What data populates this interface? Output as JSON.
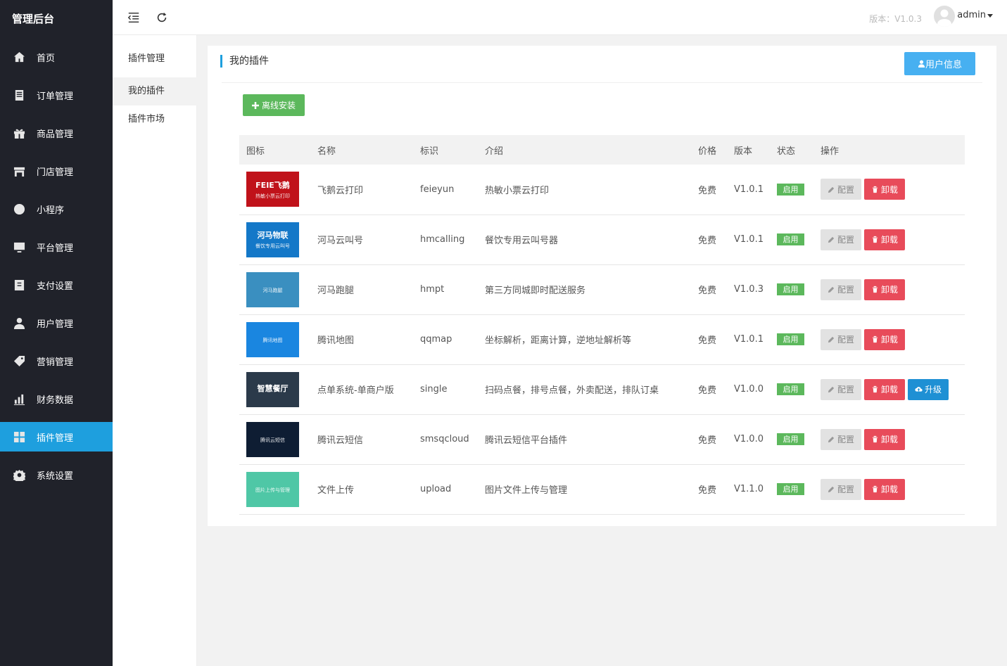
{
  "sidebar": {
    "brand": "管理后台",
    "items": [
      {
        "label": "首页",
        "icon": "home-icon"
      },
      {
        "label": "订单管理",
        "icon": "order-icon"
      },
      {
        "label": "商品管理",
        "icon": "gift-icon"
      },
      {
        "label": "门店管理",
        "icon": "store-icon"
      },
      {
        "label": "小程序",
        "icon": "miniprogram-icon"
      },
      {
        "label": "平台管理",
        "icon": "monitor-icon"
      },
      {
        "label": "支付设置",
        "icon": "payment-icon"
      },
      {
        "label": "用户管理",
        "icon": "user-icon"
      },
      {
        "label": "营销管理",
        "icon": "tag-icon"
      },
      {
        "label": "财务数据",
        "icon": "chart-icon"
      },
      {
        "label": "插件管理",
        "icon": "plugin-icon"
      },
      {
        "label": "系统设置",
        "icon": "gear-icon"
      }
    ],
    "active_index": 10
  },
  "submenu": {
    "title": "插件管理",
    "items": [
      "我的插件",
      "插件市场"
    ],
    "active_index": 0
  },
  "header": {
    "version": "版本：V1.0.3",
    "user": "admin"
  },
  "card": {
    "title": "我的插件",
    "user_info_button": "用户信息",
    "install_button": "离线安装"
  },
  "table": {
    "columns": [
      "图标",
      "名称",
      "标识",
      "介绍",
      "价格",
      "版本",
      "状态",
      "操作"
    ],
    "action_labels": {
      "config": "配置",
      "uninstall": "卸载",
      "upgrade": "升级"
    },
    "rows": [
      {
        "name": "飞鹅云打印",
        "id": "feieyun",
        "desc": "热敏小票云打印",
        "price": "免费",
        "version": "V1.0.1",
        "status": "启用",
        "upgrade": false,
        "thumb_color": "#c0121a",
        "thumb_line1": "FEIE飞鹅",
        "thumb_line2": "热敏小票云打印"
      },
      {
        "name": "河马云叫号",
        "id": "hmcalling",
        "desc": "餐饮专用云叫号器",
        "price": "免费",
        "version": "V1.0.1",
        "status": "启用",
        "upgrade": false,
        "thumb_color": "#1478c8",
        "thumb_line1": "河马物联",
        "thumb_line2": "餐饮专用云叫号"
      },
      {
        "name": "河马跑腿",
        "id": "hmpt",
        "desc": "第三方同城即时配送服务",
        "price": "免费",
        "version": "V1.0.3",
        "status": "启用",
        "upgrade": false,
        "thumb_color": "#3a8fc0",
        "thumb_line1": "",
        "thumb_line2": "河马跑腿"
      },
      {
        "name": "腾讯地图",
        "id": "qqmap",
        "desc": "坐标解析，距离计算，逆地址解析等",
        "price": "免费",
        "version": "V1.0.1",
        "status": "启用",
        "upgrade": false,
        "thumb_color": "#1a86e0",
        "thumb_line1": "",
        "thumb_line2": "腾讯地图"
      },
      {
        "name": "点单系统-单商户版",
        "id": "single",
        "desc": "扫码点餐，排号点餐，外卖配送，排队订桌",
        "price": "免费",
        "version": "V1.0.0",
        "status": "启用",
        "upgrade": true,
        "thumb_color": "#2b3a4a",
        "thumb_line1": "智慧餐厅",
        "thumb_line2": ""
      },
      {
        "name": "腾讯云短信",
        "id": "smsqcloud",
        "desc": "腾讯云短信平台插件",
        "price": "免费",
        "version": "V1.0.0",
        "status": "启用",
        "upgrade": false,
        "thumb_color": "#0e1d33",
        "thumb_line1": "",
        "thumb_line2": "腾讯云短信"
      },
      {
        "name": "文件上传",
        "id": "upload",
        "desc": "图片文件上传与管理",
        "price": "免费",
        "version": "V1.1.0",
        "status": "启用",
        "upgrade": false,
        "thumb_color": "#4fc7a6",
        "thumb_line1": "",
        "thumb_line2": "图片上传与管理"
      }
    ]
  },
  "colors": {
    "sidebar_bg": "#20222a",
    "accent": "#1e9fde",
    "success": "#5cb85c",
    "danger": "#e84b5a",
    "info": "#47b0f1"
  }
}
